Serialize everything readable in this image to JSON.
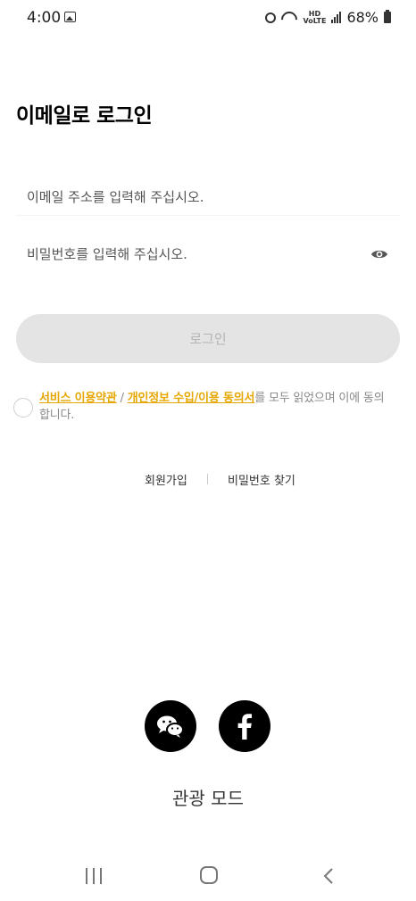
{
  "status_bar": {
    "time": "4:00",
    "network_label": "HD\nVoLTE",
    "battery": "68%"
  },
  "login": {
    "title": "이메일로 로그인",
    "email_placeholder": "이메일 주소를 입력해 주십시오.",
    "password_placeholder": "비밀번호를 입력해 주십시오.",
    "login_button": "로그인"
  },
  "agreement": {
    "terms_link": "서비스 이용약관",
    "separator": " / ",
    "privacy_link": "개인정보 수입/이용 동의서",
    "suffix": "를 모두 읽었으며 이에 동의합니다."
  },
  "links": {
    "signup": "회원가입",
    "find_password": "비밀번호 찾기"
  },
  "social": {
    "wechat_icon": "wechat-icon",
    "facebook_icon": "facebook-icon"
  },
  "tour_mode": "관광 모드",
  "colors": {
    "accent": "#e5a600",
    "button_disabled_bg": "#e4e4e4",
    "button_disabled_text": "#b4b4b4"
  }
}
